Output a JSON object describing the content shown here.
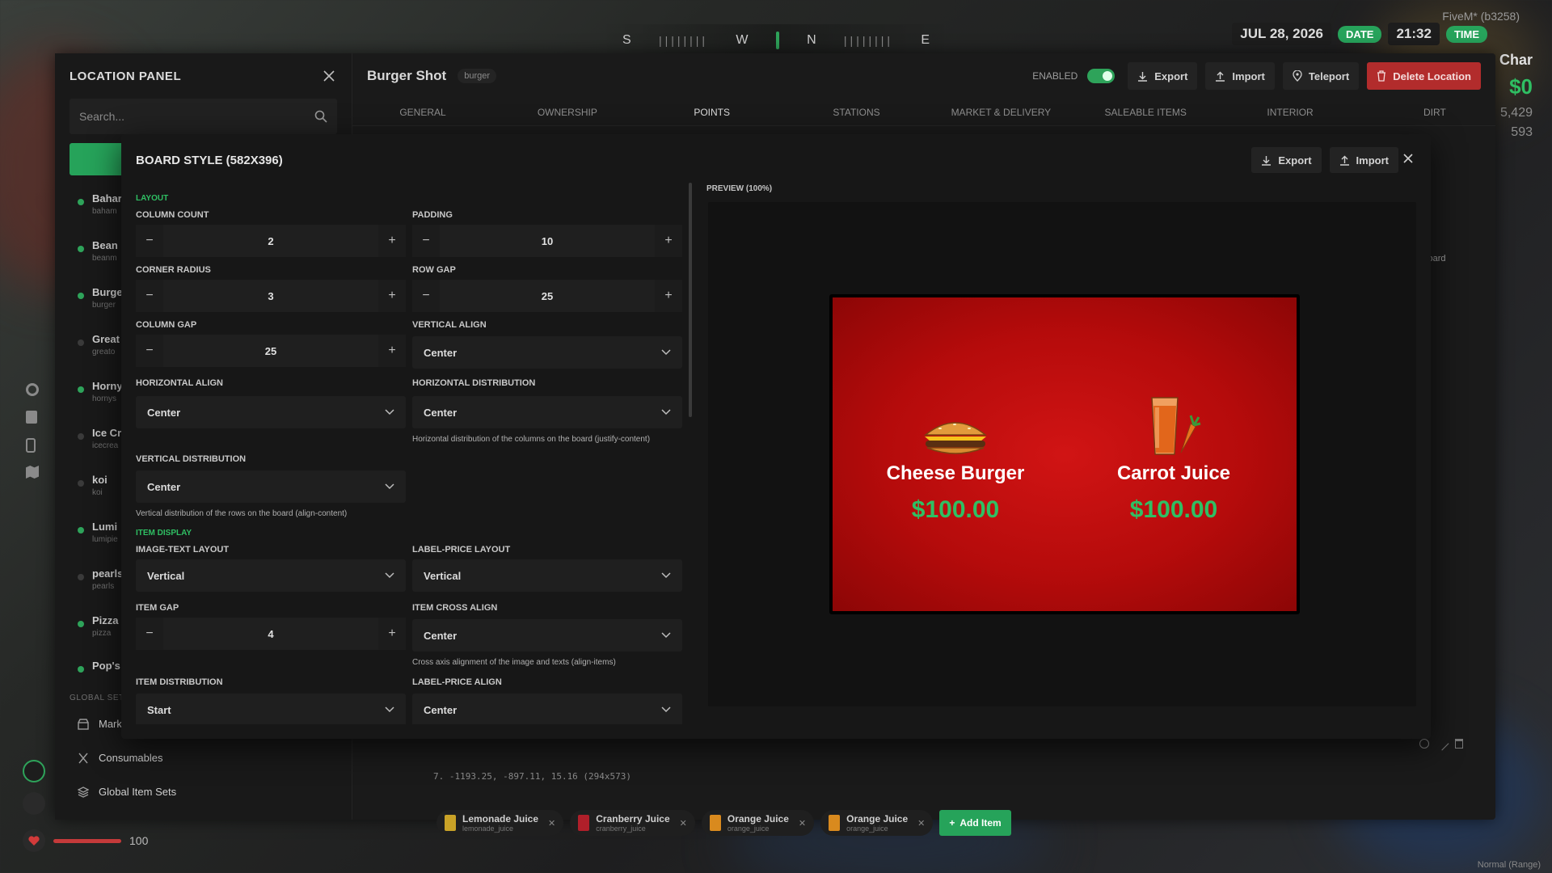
{
  "hud": {
    "compass": {
      "s": "S",
      "w": "W",
      "n": "N",
      "e": "E",
      "ticks": "||||||||"
    },
    "server": "FiveM* (b3258)",
    "date": "JUL 28, 2026",
    "date_tag": "DATE",
    "time": "21:32",
    "time_tag": "TIME",
    "char_name": "Char",
    "money": "$0",
    "extra_1": "5,429",
    "extra_2": "593",
    "health": "100",
    "mode": "Normal (Range)"
  },
  "sidebar": {
    "title": "LOCATION PANEL",
    "search_placeholder": "Search...",
    "locations": [
      {
        "name": "Bahar",
        "sub": "baham",
        "status": "#2ea35a"
      },
      {
        "name": "Bean",
        "sub": "beanm",
        "status": "#2ea35a"
      },
      {
        "name": "Burge",
        "sub": "burger",
        "status": "#2ea35a"
      },
      {
        "name": "Great",
        "sub": "greato",
        "status": "#3a3a3a"
      },
      {
        "name": "Horny",
        "sub": "hornys",
        "status": "#2ea35a"
      },
      {
        "name": "Ice Cr",
        "sub": "icecrea",
        "status": "#3a3a3a"
      },
      {
        "name": "koi",
        "sub": "koi",
        "status": "#3a3a3a"
      },
      {
        "name": "Lumi",
        "sub": "lumipie",
        "status": "#2ea35a"
      },
      {
        "name": "pearls",
        "sub": "pearls",
        "status": "#3a3a3a"
      },
      {
        "name": "Pizza",
        "sub": "pizza",
        "status": "#2ea35a"
      },
      {
        "name": "Pop's",
        "sub": "",
        "status": "#2ea35a"
      }
    ],
    "global_label": "GLOBAL SETT",
    "global_items": [
      {
        "label": "Mark",
        "icon": "store-icon"
      },
      {
        "label": "Consumables",
        "icon": "utensils-icon"
      },
      {
        "label": "Global Item Sets",
        "icon": "layers-icon"
      }
    ]
  },
  "header": {
    "title": "Burger Shot",
    "badge": "burger",
    "enabled_label": "ENABLED",
    "export_label": "Export",
    "import_label": "Import",
    "teleport_label": "Teleport",
    "delete_label": "Delete Location"
  },
  "tabs": [
    "GENERAL",
    "OWNERSHIP",
    "POINTS",
    "STATIONS",
    "MARKET & DELIVERY",
    "SALEABLE ITEMS",
    "INTERIOR",
    "DIRT"
  ],
  "active_tab": "POINTS",
  "points": {
    "ghost_button": "d Board",
    "row_text": "7. -1193.25, -897.11, 15.16 (294x573)",
    "chips": [
      {
        "title": "Lemonade Juice",
        "sub": "lemonade_juice",
        "color": "#c9a227"
      },
      {
        "title": "Cranberry Juice",
        "sub": "cranberry_juice",
        "color": "#b01f2a"
      },
      {
        "title": "Orange Juice",
        "sub": "orange_juice",
        "color": "#d98a1e"
      },
      {
        "title": "Orange Juice",
        "sub": "orange_juice",
        "color": "#d98a1e"
      }
    ],
    "add_item": "Add Item"
  },
  "modal": {
    "title": "BOARD STYLE (582X396)",
    "export_label": "Export",
    "import_label": "Import",
    "layout_section": "LAYOUT",
    "item_display_section": "ITEM DISPLAY",
    "column_count": {
      "label": "COLUMN COUNT",
      "value": "2"
    },
    "padding": {
      "label": "PADDING",
      "value": "10"
    },
    "corner_radius": {
      "label": "CORNER RADIUS",
      "value": "3"
    },
    "row_gap": {
      "label": "ROW GAP",
      "value": "25"
    },
    "column_gap": {
      "label": "COLUMN GAP",
      "value": "25"
    },
    "vertical_align": {
      "label": "VERTICAL ALIGN",
      "value": "Center"
    },
    "horizontal_align": {
      "label": "HORIZONTAL ALIGN",
      "value": "Center"
    },
    "horizontal_distribution": {
      "label": "HORIZONTAL DISTRIBUTION",
      "value": "Center",
      "help": "Horizontal distribution of the columns on the board (justify-content)"
    },
    "vertical_distribution": {
      "label": "VERTICAL DISTRIBUTION",
      "value": "Center",
      "help": "Vertical distribution of the rows on the board (align-content)"
    },
    "image_text_layout": {
      "label": "IMAGE-TEXT LAYOUT",
      "value": "Vertical"
    },
    "label_price_layout": {
      "label": "LABEL-PRICE LAYOUT",
      "value": "Vertical"
    },
    "item_gap": {
      "label": "ITEM GAP",
      "value": "4"
    },
    "item_cross_align": {
      "label": "ITEM CROSS ALIGN",
      "value": "Center",
      "help": "Cross axis alignment of the image and texts (align-items)"
    },
    "item_distribution": {
      "label": "ITEM DISTRIBUTION",
      "value": "Start"
    },
    "label_price_align": {
      "label": "LABEL-PRICE ALIGN",
      "value": "Center"
    },
    "preview_label": "PREVIEW (100%)",
    "board_items": [
      {
        "name": "Cheese Burger",
        "price": "$100.00",
        "icon": "burger-icon"
      },
      {
        "name": "Carrot Juice",
        "price": "$100.00",
        "icon": "carrot-juice-icon"
      }
    ]
  },
  "colors": {
    "accent": "#2ea35a",
    "danger": "#b22c2c",
    "price": "#2fbf63",
    "board_bg": "#c40f0f"
  }
}
